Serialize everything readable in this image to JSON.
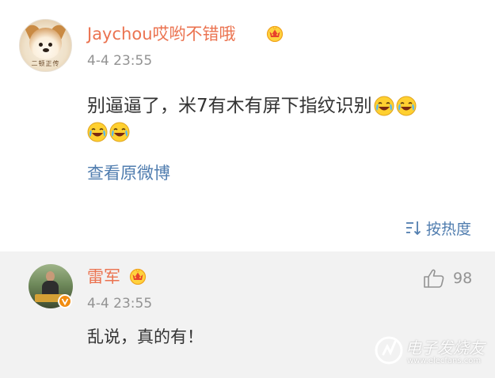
{
  "post": {
    "author": "Jaychou哎哟不错哦",
    "timestamp": "4-4 23:55",
    "avatar_caption": "二顿正传",
    "body": "别逼逼了，米7有木有屏下指纹识别",
    "emoji": "laugh-cry-emoji",
    "view_original_label": "查看原微博",
    "sort_label": "按热度"
  },
  "reply": {
    "author": "雷军",
    "timestamp": "4-4 23:55",
    "text": "乱说，真的有！",
    "like_count": "98"
  },
  "watermark": {
    "title": "电子发烧友",
    "url": "www.elecfans.com"
  },
  "colors": {
    "username": "#eb7350",
    "link": "#507daf",
    "meta": "#939393",
    "reply_background": "#f2f2f2"
  }
}
